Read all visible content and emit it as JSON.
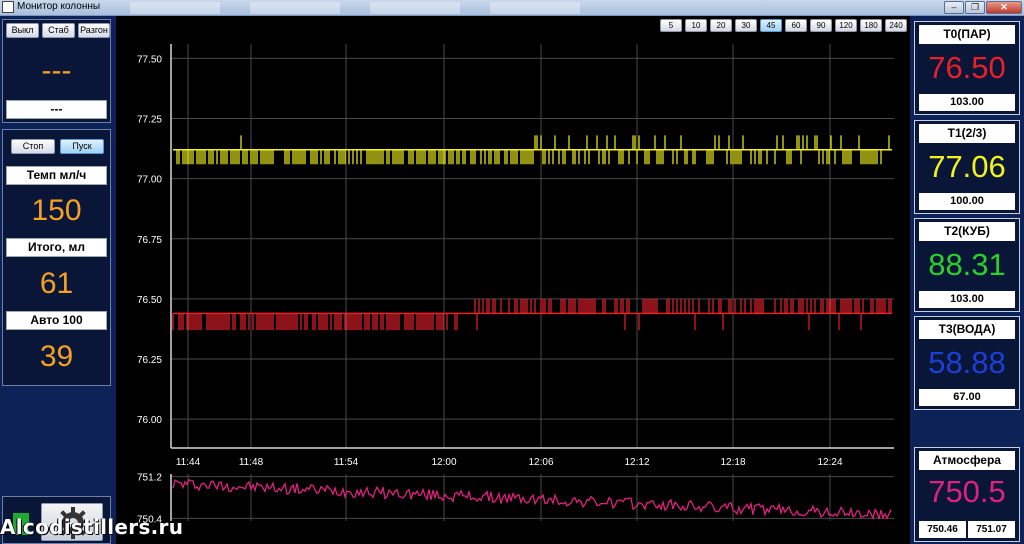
{
  "window": {
    "title": "Монитор колонны",
    "controls": [
      "–",
      "❐",
      "✕"
    ]
  },
  "left_panel": {
    "mode_buttons": [
      "Выкл",
      "Стаб",
      "Разгон"
    ],
    "mode_value": "---",
    "mode_sub": "---",
    "flow_buttons": {
      "stop": "Стоп",
      "start": "Пуск"
    },
    "rate_label": "Темп мл/ч",
    "rate_value": "150",
    "total_label": "Итого, мл",
    "total_value": "61",
    "auto_label": "Авто 100",
    "auto_value": "39",
    "settings_icon": "gear-icon",
    "status_color": "#1fa832"
  },
  "range_buttons": [
    "5",
    "10",
    "20",
    "30",
    "45",
    "60",
    "90",
    "120",
    "180",
    "240"
  ],
  "range_selected": "45",
  "right_panel": {
    "sensors": [
      {
        "name": "T0(ПАР)",
        "value": "76.50",
        "sub": "103.00",
        "color": "#e8202a"
      },
      {
        "name": "T1(2/3)",
        "value": "77.06",
        "sub": "100.00",
        "color": "#f2f21e"
      },
      {
        "name": "T2(КУБ)",
        "value": "88.31",
        "sub": "103.00",
        "color": "#2ad02a"
      },
      {
        "name": "T3(ВОДА)",
        "value": "58.88",
        "sub": "67.00",
        "color": "#1c3fd6"
      }
    ],
    "pressure": {
      "name": "Атмосфера",
      "value": "750.5",
      "min": "750.46",
      "max": "751.07",
      "color": "#e0207f"
    }
  },
  "watermark": "Alcodistillers.ru",
  "chart_data": [
    {
      "type": "line",
      "title": "",
      "xlabel": "",
      "ylabel": "",
      "x_ticks": [
        "11:44",
        "11:48",
        "11:54",
        "12:00",
        "12:06",
        "12:12",
        "12:18",
        "12:24"
      ],
      "y_ticks": [
        "77.50",
        "77.25",
        "77.00",
        "76.75",
        "76.50",
        "76.25",
        "76.00"
      ],
      "ylim": [
        75.88,
        77.56
      ],
      "grid": true,
      "series": [
        {
          "color": "#f2f21e",
          "base": 77.12,
          "low": 77.06,
          "high": 77.18
        },
        {
          "color": "#e8202a",
          "base": 76.44,
          "low": 76.37,
          "high": 76.5
        }
      ]
    },
    {
      "type": "line",
      "title": "",
      "y_ticks": [
        "751.2",
        "750.4"
      ],
      "ylim": [
        750.35,
        751.25
      ],
      "grid": true,
      "series": [
        {
          "color": "#e0207f",
          "start": 751.07,
          "end": 750.46
        }
      ]
    }
  ]
}
